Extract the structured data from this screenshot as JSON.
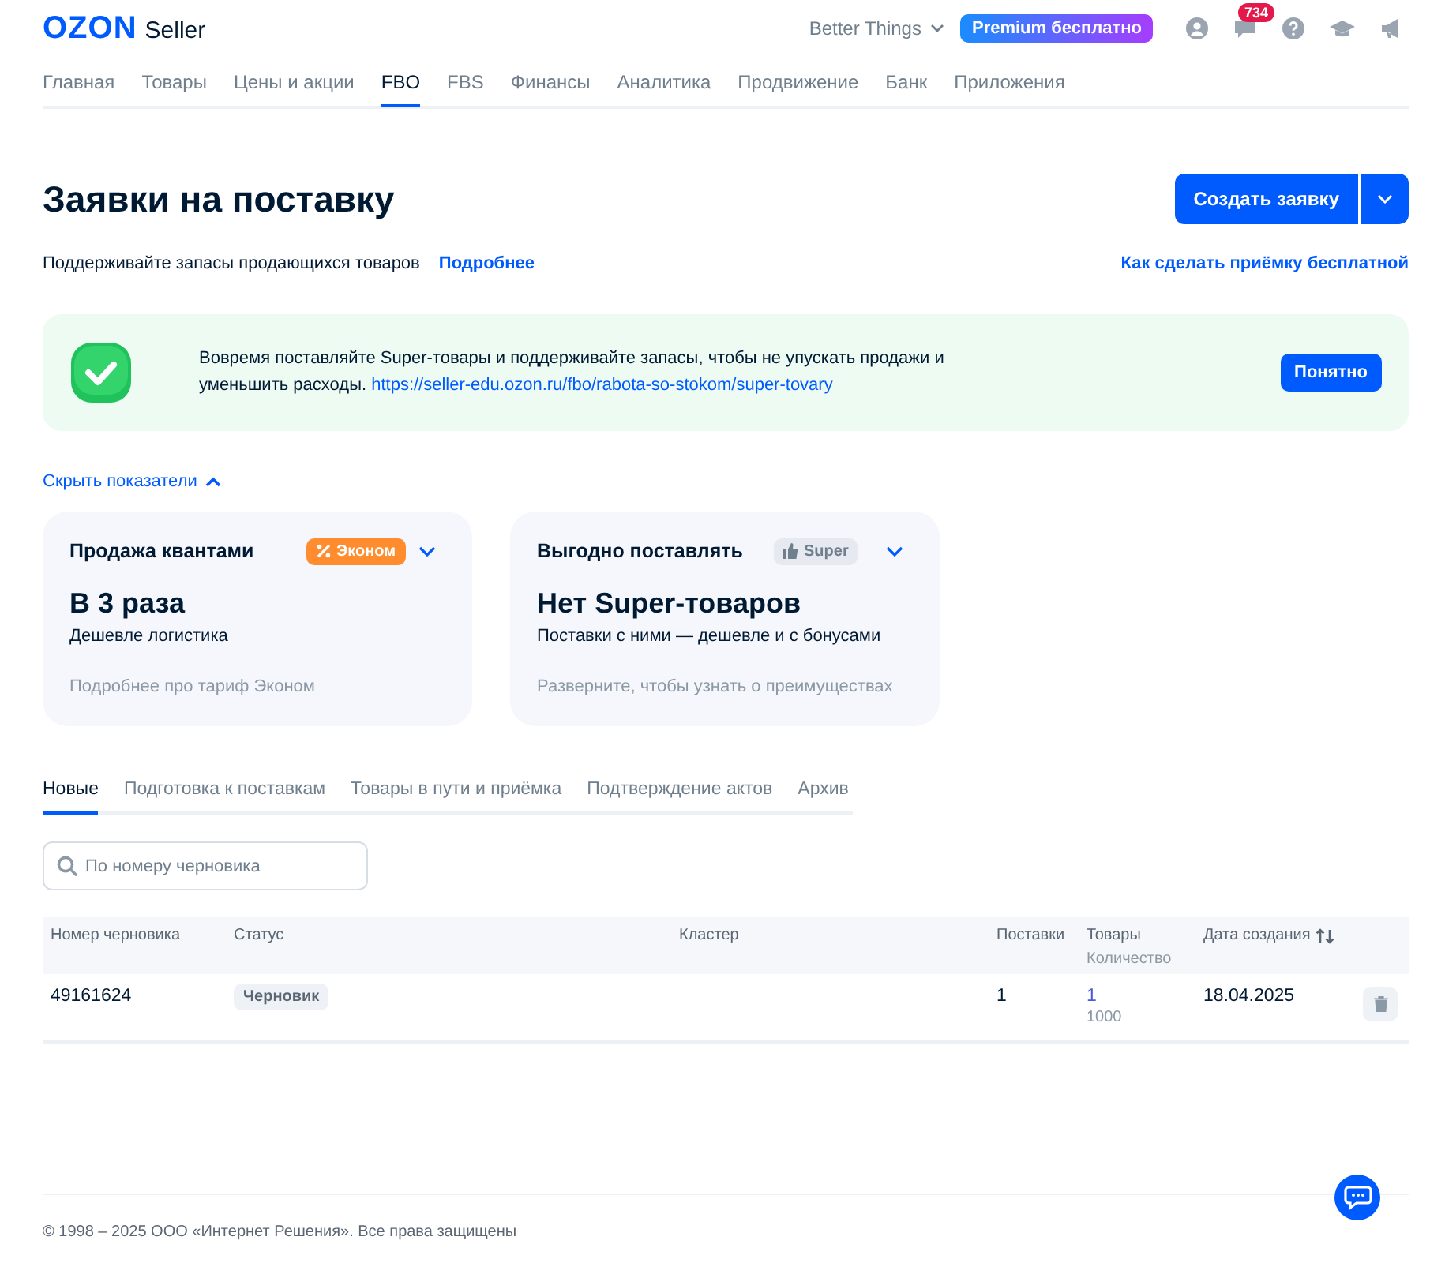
{
  "header": {
    "logo": {
      "brand": "OZON",
      "product": "Seller"
    },
    "account": "Better Things",
    "premium_badge": "Premium бесплатно",
    "notifications_count": "734"
  },
  "nav": [
    {
      "label": "Главная",
      "selected": false
    },
    {
      "label": "Товары",
      "selected": false
    },
    {
      "label": "Цены и акции",
      "selected": false
    },
    {
      "label": "FBO",
      "selected": true
    },
    {
      "label": "FBS",
      "selected": false
    },
    {
      "label": "Финансы",
      "selected": false
    },
    {
      "label": "Аналитика",
      "selected": false
    },
    {
      "label": "Продвижение",
      "selected": false
    },
    {
      "label": "Банк",
      "selected": false
    },
    {
      "label": "Приложения",
      "selected": false
    }
  ],
  "page": {
    "title": "Заявки на поставку",
    "create_button": "Создать заявку",
    "subtitle": "Поддерживайте запасы продающихся товаров",
    "more_link": "Подробнее",
    "right_link": "Как сделать приёмку бесплатной"
  },
  "banner": {
    "text": "Вовремя поставляйте Super-товары и поддерживайте запасы, чтобы не упускать продажи и уменьшить расходы.",
    "link": "https://seller-edu.ozon.ru/fbo/rabota-so-stokom/super-tovary",
    "button": "Понятно"
  },
  "indicators_toggle": {
    "label": "Скрыть показатели",
    "expanded": true
  },
  "cards": [
    {
      "title": "Продажа квантами",
      "badge": "Эконом",
      "kind": "econom",
      "headline": "В 3 раза",
      "sub": "Дешевле логистика",
      "hint": "Подробнее про тариф Эконом"
    },
    {
      "title": "Выгодно поставлять",
      "badge": "Super",
      "kind": "super",
      "headline": "Нет Super-товаров",
      "sub": "Поставки с ними — дешевле и с бонусами",
      "hint": "Разверните, чтобы узнать о преимуществах"
    }
  ],
  "tabs": [
    {
      "label": "Новые",
      "selected": true
    },
    {
      "label": "Подготовка к поставкам",
      "selected": false
    },
    {
      "label": "Товары в пути и приёмка",
      "selected": false
    },
    {
      "label": "Подтверждение актов",
      "selected": false
    },
    {
      "label": "Архив",
      "selected": false
    }
  ],
  "search": {
    "placeholder": "По номеру черновика"
  },
  "table": {
    "columns": [
      {
        "label": "Номер черновика"
      },
      {
        "label": "Статус"
      },
      {
        "label": "Кластер"
      },
      {
        "label": "Поставки"
      },
      {
        "label": "Товары",
        "sublabel": "Количество"
      },
      {
        "label": "Дата создания",
        "sortable": true
      }
    ],
    "rows": [
      {
        "number": "49161624",
        "status": "Черновик",
        "supplies": "1",
        "goods": "1",
        "quantity": "1000",
        "date": "18.04.2025"
      }
    ]
  },
  "footer": "© 1998 – 2025 ООО «Интернет Решения». Все права защищены"
}
